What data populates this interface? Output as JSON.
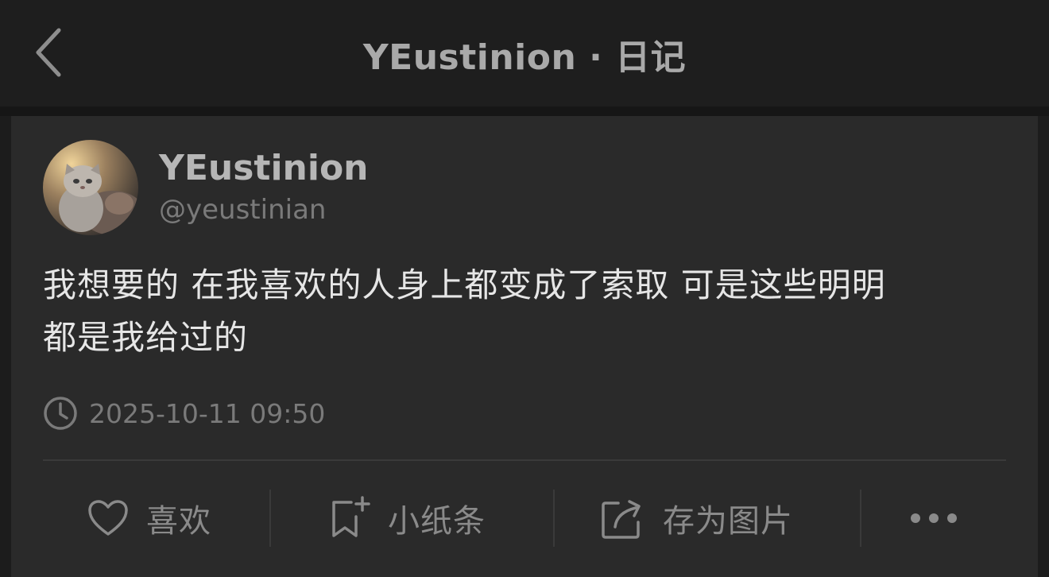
{
  "header": {
    "title": "YEustinion · 日记",
    "back_icon": "chevron-left-icon"
  },
  "post": {
    "author_name": "YEustinion",
    "author_handle": "@yeustinian",
    "content_line1": "我想要的 在我喜欢的人身上都变成了索取 可是这些明明",
    "content_line2": "都是我给过的",
    "timestamp": "2025-10-11 09:50"
  },
  "actions": {
    "like_label": "喜欢",
    "note_label": "小纸条",
    "save_image_label": "存为图片",
    "more_icon": "more-dots-icon"
  },
  "colors": {
    "background": "#1c1c1c",
    "card": "#2a2a2a",
    "text_primary": "#e6e6e6",
    "text_secondary": "#7a7a7a"
  }
}
